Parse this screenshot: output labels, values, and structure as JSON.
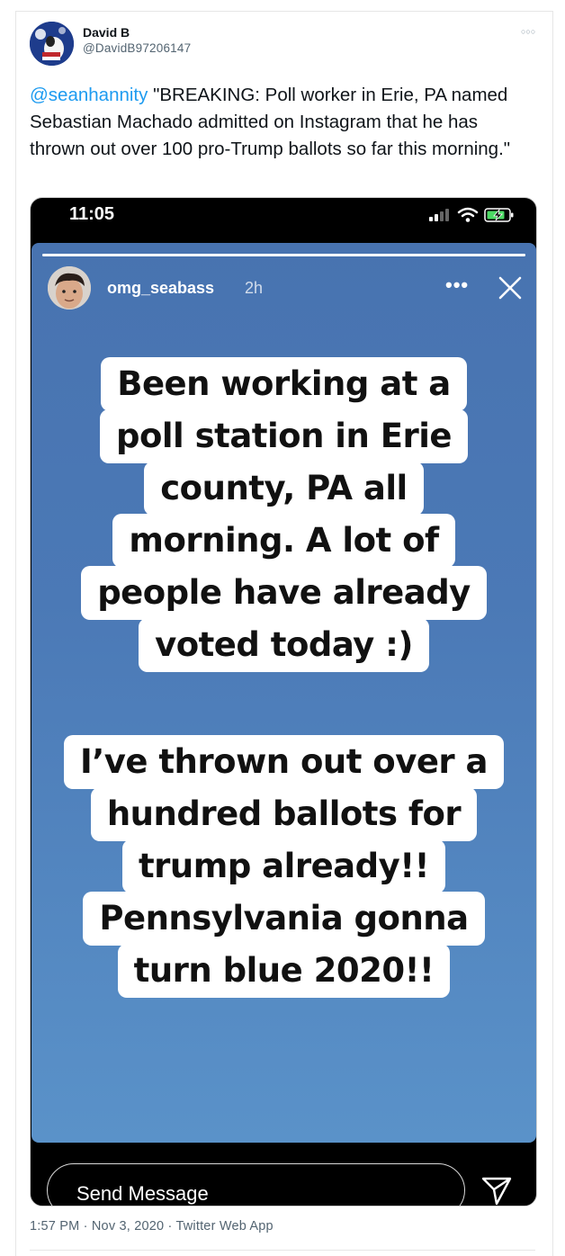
{
  "tweet": {
    "author_name": "David B",
    "author_handle": "@DavidB97206147",
    "more_icon": "more-icon",
    "mention": "@seanhannity",
    "text": " \"BREAKING: Poll worker in Erie, PA named Sebastian Machado admitted on Instagram that he has thrown out over 100 pro-Trump ballots so far this morning.\"",
    "timestamp": "1:57 PM · Nov 3, 2020 · Twitter Web App"
  },
  "phone": {
    "status_time": "11:05",
    "icons": [
      "signal-icon",
      "wifi-icon",
      "battery-charging-icon"
    ],
    "story": {
      "username": "omg_seabass",
      "age": "2h",
      "progress": 1.0,
      "caption_1": [
        "Been working at a",
        "poll station in Erie",
        "county, PA all",
        "morning. A lot of",
        "people have already",
        "voted today :)"
      ],
      "caption_2": [
        "I’ve thrown out over a",
        "hundred ballots for",
        "trump already!!",
        "Pennsylvania gonna",
        "turn blue 2020!!"
      ],
      "message_placeholder": "Send Message"
    }
  },
  "colors": {
    "mention": "#1d9bf0",
    "story_top": "#4873b0",
    "story_bottom": "#5a92c9"
  }
}
